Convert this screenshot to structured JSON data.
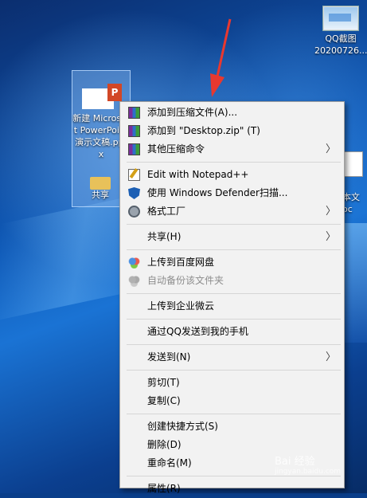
{
  "desktop": {
    "qq_file": {
      "line1": "QQ截图",
      "line2": "20200726..."
    },
    "ppt_file": {
      "badge": "P",
      "label": "新建 Microsoft PowerPoint 演示文稿.pptx"
    },
    "share_folder": {
      "label": "共享"
    },
    "txt_file": {
      "label": "本文",
      "label2": "oc"
    }
  },
  "context_menu": {
    "items": [
      {
        "label": "添加到压缩文件(A)...",
        "icon": "winrar-icon"
      },
      {
        "label": "添加到 \"Desktop.zip\" (T)",
        "icon": "winrar-icon"
      },
      {
        "label": "其他压缩命令",
        "icon": "winrar-icon",
        "submenu": true
      },
      {
        "label": "Edit with Notepad++",
        "icon": "notepad-plus-icon"
      },
      {
        "label": "使用 Windows Defender扫描...",
        "icon": "defender-shield-icon"
      },
      {
        "label": "格式工厂",
        "icon": "format-factory-icon",
        "submenu": true
      },
      {
        "label": "共享(H)",
        "submenu": true
      },
      {
        "label": "上传到百度网盘",
        "icon": "baidu-cloud-icon"
      },
      {
        "label": "自动备份该文件夹",
        "icon": "baidu-cloud-icon",
        "disabled": true
      },
      {
        "label": "上传到企业微云"
      },
      {
        "label": "通过QQ发送到我的手机"
      },
      {
        "label": "发送到(N)",
        "submenu": true
      },
      {
        "label": "剪切(T)"
      },
      {
        "label": "复制(C)"
      },
      {
        "label": "创建快捷方式(S)"
      },
      {
        "label": "删除(D)"
      },
      {
        "label": "重命名(M)"
      },
      {
        "label": "属性(R)"
      }
    ],
    "submenu_glyph": "〉"
  },
  "watermark": {
    "main": "Bai 经验",
    "sub": "jingyan.baidu.com"
  },
  "colors": {
    "arrow": "#e8382f",
    "menu_bg": "#f2f2f2",
    "selection": "#7aaae6"
  }
}
